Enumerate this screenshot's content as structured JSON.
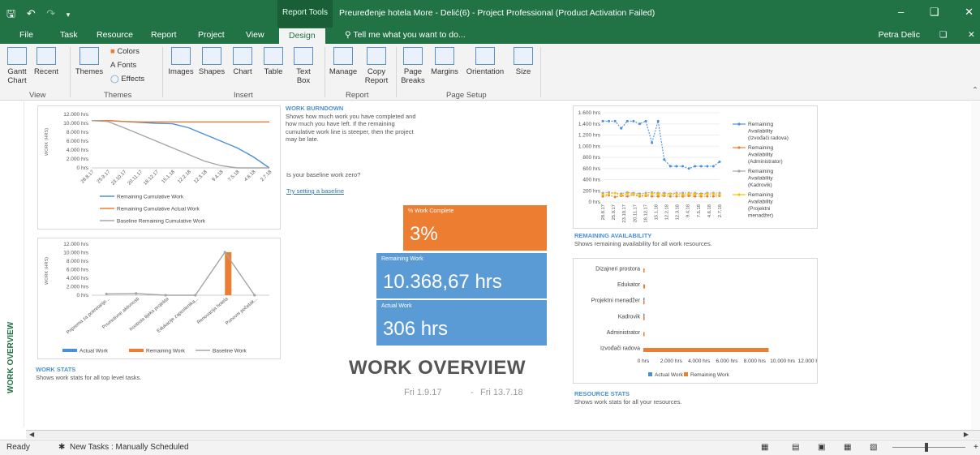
{
  "window": {
    "title": "Preuređenje hotela More - Delić(6) - Project Professional (Product Activation Failed)",
    "tools_label": "Report Tools",
    "user": "Petra Delic"
  },
  "tabs": [
    "File",
    "Task",
    "Resource",
    "Report",
    "Project",
    "View",
    "Design"
  ],
  "tell_me": "Tell me what you want to do...",
  "ribbon": {
    "buttons": [
      {
        "label": "Gantt\nChart"
      },
      {
        "label": "Recent"
      },
      {
        "label": "Themes"
      },
      {
        "label": "Images"
      },
      {
        "label": "Shapes"
      },
      {
        "label": "Chart"
      },
      {
        "label": "Table"
      },
      {
        "label": "Text\nBox"
      },
      {
        "label": "Manage"
      },
      {
        "label": "Copy\nReport"
      },
      {
        "label": "Page\nBreaks"
      },
      {
        "label": "Margins"
      },
      {
        "label": "Orientation"
      },
      {
        "label": "Size"
      }
    ],
    "theme_items": [
      "Colors",
      "Fonts",
      "Effects"
    ],
    "groups": [
      "View",
      "Themes",
      "Insert",
      "Report",
      "Page Setup"
    ]
  },
  "sidebar": {
    "label": "WORK OVERVIEW"
  },
  "burndown": {
    "header": "WORK BURNDOWN",
    "text": "Shows how much work you have completed and how much you have left. If the remaining cumulative work line is steeper, then the project may be late.",
    "question": "Is your baseline work zero?",
    "link": "Try setting a baseline"
  },
  "tiles": {
    "pct_label": "% Work Complete",
    "pct_value": "3%",
    "rem_label": "Remaining Work",
    "rem_value": "10.368,67 hrs",
    "act_label": "Actual Work",
    "act_value": "306 hrs"
  },
  "overview": {
    "title": "WORK OVERVIEW",
    "start": "Fri 1.9.17",
    "end": "Fri 13.7.18",
    "sep": "-"
  },
  "work_stats": {
    "header": "WORK STATS",
    "text": "Shows work stats for all top level tasks."
  },
  "remaining_availability": {
    "header": "REMAINING AVAILABILITY",
    "text": "Shows remaining availability for all work resources."
  },
  "resource_stats": {
    "header": "RESOURCE STATS",
    "text": "Shows work stats for all your resources."
  },
  "status": {
    "ready": "Ready",
    "new_tasks": "New Tasks : Manually Scheduled"
  },
  "colors": {
    "green": "#217346",
    "blue": "#4a90d9",
    "orange": "#ed7d31",
    "gray": "#a5a5a5",
    "yellow": "#ffc000"
  },
  "chart_data": [
    {
      "type": "line",
      "ylabel": "WORK (HRS)",
      "y_ticks": [
        "12.000 hrs",
        "10.000 hrs",
        "8.000 hrs",
        "6.000 hrs",
        "4.000 hrs",
        "2.000 hrs",
        "0 hrs"
      ],
      "ylim": [
        0,
        12000
      ],
      "categories": [
        "28.8.17",
        "25.9.17",
        "23.10.17",
        "20.11.17",
        "18.12.17",
        "15.1.18",
        "12.2.18",
        "12.3.18",
        "9.4.18",
        "7.5.18",
        "4.6.18",
        "2.7.18"
      ],
      "series": [
        {
          "name": "Remaining Cumulative Work",
          "color": "#4a90d9",
          "values": [
            10600,
            10600,
            10400,
            10200,
            10000,
            9900,
            9000,
            7500,
            6000,
            4500,
            2500,
            0
          ]
        },
        {
          "name": "Remaining Cumulative Actual Work",
          "color": "#ed7d31",
          "values": [
            10600,
            10600,
            10400,
            10300,
            10300,
            10300,
            10300,
            10300,
            10300,
            10300,
            10300,
            10300
          ]
        },
        {
          "name": "Baseline Remaining Cumulative Work",
          "color": "#a5a5a5",
          "values": [
            10600,
            10400,
            9000,
            7500,
            6000,
            4500,
            3000,
            1500,
            500,
            0,
            0,
            0
          ]
        }
      ],
      "legend": "bottom"
    },
    {
      "type": "bar",
      "ylabel": "WORK (HRS)",
      "y_ticks": [
        "12.000 hrs",
        "10.000 hrs",
        "8.000 hrs",
        "6.000 hrs",
        "4.000 hrs",
        "2.000 hrs",
        "0 hrs"
      ],
      "ylim": [
        0,
        12000
      ],
      "categories": [
        "Priprema za pokretanje...",
        "Promotivne aktivnosti",
        "Kontrola tijeka projekta",
        "Edukacije zaposlenika...",
        "Renovacija hotela",
        "Ponovni početak..."
      ],
      "series": [
        {
          "name": "Actual Work",
          "color": "#4a90d9",
          "values": [
            0,
            0,
            0,
            0,
            0,
            0
          ]
        },
        {
          "name": "Remaining Work",
          "color": "#ed7d31",
          "values": [
            0,
            0,
            0,
            0,
            10100,
            0
          ]
        },
        {
          "name": "Baseline Work",
          "color": "#a5a5a5",
          "values": [
            300,
            400,
            0,
            0,
            10100,
            0
          ]
        }
      ],
      "legend": "bottom"
    },
    {
      "type": "line",
      "y_ticks": [
        "1.600 hrs",
        "1.400 hrs",
        "1.200 hrs",
        "1.000 hrs",
        "800 hrs",
        "600 hrs",
        "400 hrs",
        "200 hrs",
        "0 hrs"
      ],
      "ylim": [
        0,
        1600
      ],
      "categories": [
        "28.8.17",
        "25.9.17",
        "23.10.17",
        "20.11.17",
        "18.12.17",
        "15.1.18",
        "12.2.18",
        "12.3.18",
        "9.4.18",
        "7.5.18",
        "4.6.18",
        "2.7.18"
      ],
      "series": [
        {
          "name": "Remaining Availability (Izvođači radova)",
          "color": "#4a90d9",
          "values": [
            1450,
            1450,
            1450,
            1320,
            1450,
            1450,
            1400,
            1450,
            1060,
            1450,
            760,
            640,
            640,
            640,
            600,
            640,
            640,
            640,
            640,
            720
          ]
        },
        {
          "name": "Remaining Availability (Administrator)",
          "color": "#ed7d31",
          "values": [
            100,
            120,
            90,
            110,
            100,
            130,
            100,
            110,
            100,
            100,
            110,
            100,
            100,
            100,
            110,
            100,
            100,
            100,
            100,
            110
          ]
        },
        {
          "name": "Remaining Availability (Kadrovik)",
          "color": "#a5a5a5",
          "values": [
            160,
            170,
            160,
            150,
            170,
            160,
            150,
            160,
            170,
            160,
            160,
            150,
            160,
            160,
            160,
            160,
            150,
            160,
            160,
            160
          ]
        },
        {
          "name": "Remaining Availability (Projektni menadžer)",
          "color": "#ffc000",
          "values": [
            130,
            140,
            160,
            120,
            150,
            140,
            120,
            130,
            150,
            140,
            130,
            140,
            140,
            130,
            140,
            140,
            130,
            140,
            140,
            130
          ]
        }
      ],
      "legend": "right"
    },
    {
      "type": "bar",
      "orientation": "horizontal",
      "categories": [
        "Dizajneri prostora",
        "Edukator",
        "Projektni menadžer",
        "Kadrovik",
        "Administrator",
        "Izvođači radova"
      ],
      "x_ticks": [
        "0 hrs",
        "2.000 hrs",
        "4.000 hrs",
        "6.000 hrs",
        "8.000 hrs",
        "10.000 hrs",
        "12.000 hrs"
      ],
      "xlim": [
        0,
        12000
      ],
      "series": [
        {
          "name": "Actual Work",
          "color": "#4a90d9",
          "values": [
            0,
            0,
            30,
            40,
            0,
            0
          ]
        },
        {
          "name": "Remaining Work",
          "color": "#ed7d31",
          "values": [
            60,
            120,
            60,
            80,
            30,
            9000
          ]
        }
      ],
      "legend": "bottom"
    }
  ]
}
